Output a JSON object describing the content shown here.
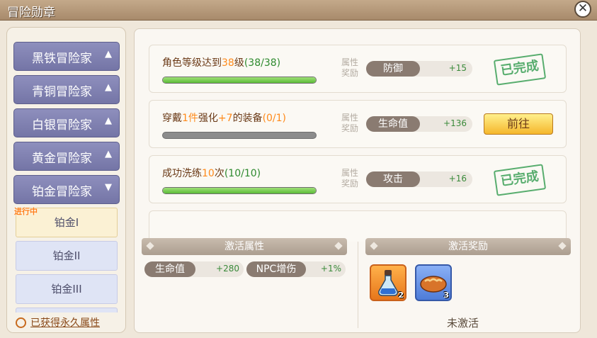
{
  "window": {
    "title": "冒险勋章",
    "close_label": "✕"
  },
  "sidebar": {
    "tiers": [
      {
        "label": "黑铁冒险家",
        "arrow": "▲"
      },
      {
        "label": "青铜冒险家",
        "arrow": "▲"
      },
      {
        "label": "白银冒险家",
        "arrow": "▲"
      },
      {
        "label": "黄金冒险家",
        "arrow": "▲"
      },
      {
        "label": "铂金冒险家",
        "arrow": "▼"
      }
    ],
    "in_progress": "进行中",
    "sub_items": [
      {
        "label": "铂金I"
      },
      {
        "label": "铂金II"
      },
      {
        "label": "铂金III"
      }
    ],
    "permanent_link": "已获得永久属性"
  },
  "quests": [
    {
      "pre": "角色等级达到",
      "hl": "38",
      "post": "级",
      "progress": "(38/38)",
      "fraction": 1.0,
      "attr_tag": "属性奖励",
      "attr": "防御",
      "value": "+15",
      "state": "已完成"
    },
    {
      "pre": "穿戴",
      "hl": "1件",
      "mid": "强化",
      "hl2": "+7",
      "post": "的装备",
      "progress": "(0/1)",
      "fraction": 0.0,
      "attr_tag": "属性奖励",
      "attr": "生命值",
      "value": "+136",
      "button": "前往"
    },
    {
      "pre": "成功洗练",
      "hl": "10",
      "post": "次",
      "progress": "(10/10)",
      "fraction": 1.0,
      "attr_tag": "属性奖励",
      "attr": "攻击",
      "value": "+16",
      "state": "已完成"
    }
  ],
  "activate": {
    "attr_header": "激活属性",
    "reward_header": "激活奖励",
    "stats": [
      {
        "name": "生命值",
        "value": "+280"
      },
      {
        "name": "NPC增伤",
        "value": "+1%"
      }
    ],
    "rewards": [
      {
        "icon": "potion-icon",
        "count": "2"
      },
      {
        "icon": "bread-icon",
        "count": "3"
      }
    ],
    "status": "未激活"
  },
  "colors": {
    "tier_button": "#7f80b1",
    "progress_fill": "#6cc443",
    "highlight": "#ff8a1a",
    "stamp": "#58ad6e"
  }
}
